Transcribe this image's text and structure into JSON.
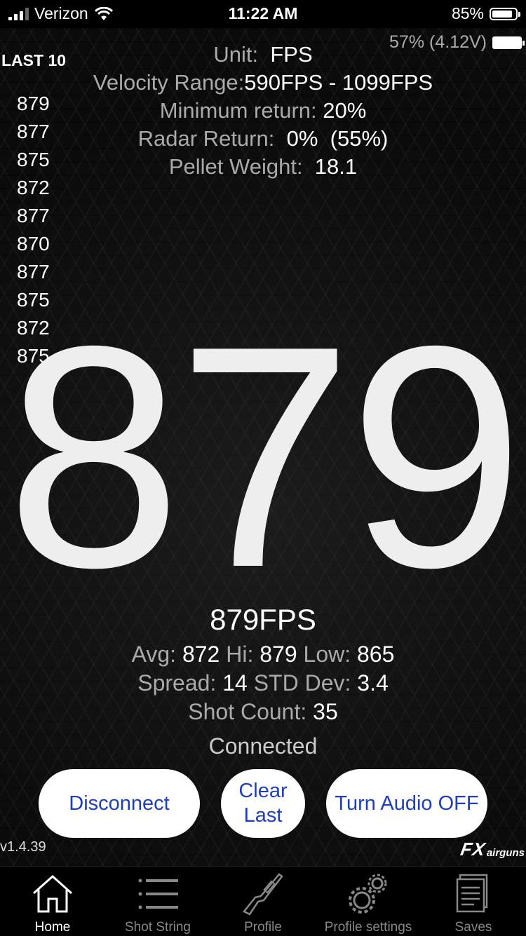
{
  "status_bar": {
    "carrier": "Verizon",
    "time": "11:22 AM",
    "battery": "85%"
  },
  "device_battery": "57% (4.12V)",
  "info": {
    "unit_label": "Unit:",
    "unit_value": "FPS",
    "range_label": "Velocity Range:",
    "range_value": "590FPS - 1099FPS",
    "min_return_label": "Minimum return:",
    "min_return_value": "20%",
    "radar_label": "Radar Return:",
    "radar_value": "0%",
    "radar_peak": "(55%)",
    "pellet_label": "Pellet Weight:",
    "pellet_value": "18.1"
  },
  "last10": {
    "title": "LAST 10",
    "shots": [
      "879",
      "877",
      "875",
      "872",
      "877",
      "870",
      "877",
      "875",
      "872",
      "875"
    ]
  },
  "current_velocity": "879",
  "current_velocity_unit_text": "879FPS",
  "stats": {
    "avg_label": "Avg:",
    "avg": "872",
    "hi_label": "Hi:",
    "hi": "879",
    "low_label": "Low:",
    "low": "865",
    "spread_label": "Spread:",
    "spread": "14",
    "std_label": "STD Dev:",
    "std": "3.4",
    "count_label": "Shot Count:",
    "count": "35"
  },
  "connection_status": "Connected",
  "buttons": {
    "disconnect": "Disconnect",
    "clear_1": "Clear",
    "clear_2": "Last",
    "audio": "Turn Audio OFF"
  },
  "version": "v1.4.39",
  "logo": {
    "fx": "FX",
    "airguns": "airguns"
  },
  "tabs": [
    {
      "label": "Home",
      "icon": "home-icon"
    },
    {
      "label": "Shot String",
      "icon": "list-icon"
    },
    {
      "label": "Profile",
      "icon": "rifle-icon"
    },
    {
      "label": "Profile settings",
      "icon": "gears-icon"
    },
    {
      "label": "Saves",
      "icon": "documents-icon"
    }
  ],
  "colors": {
    "background": "#000000",
    "button_text": "#1d3fbf",
    "muted_text": "#aaaaaa"
  }
}
